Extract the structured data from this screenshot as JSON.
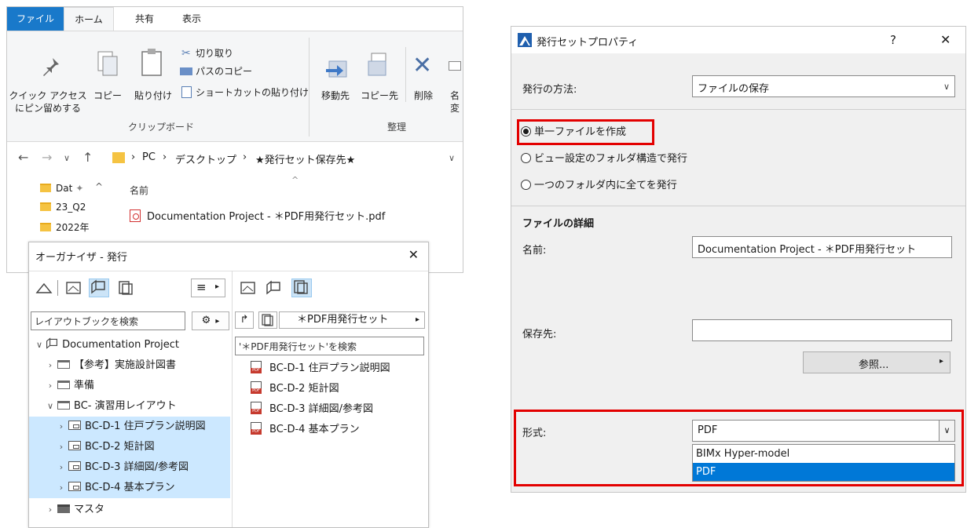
{
  "explorer": {
    "tabs": [
      "ファイル",
      "ホーム",
      "共有",
      "表示"
    ],
    "pin_label_1": "クイック アクセス",
    "pin_label_2": "にピン留めする",
    "copy_label": "コピー",
    "paste_label": "貼り付け",
    "cut_label": "切り取り",
    "copy_path_label": "パスのコピー",
    "paste_shortcut_label": "ショートカットの貼り付け",
    "clipboard_group": "クリップボード",
    "move_label": "移動先",
    "copyto_label": "コピー先",
    "delete_label": "削除",
    "rename_label_1": "名",
    "rename_label_2": "変",
    "organize_group": "整理",
    "breadcrumb": [
      "PC",
      "デスクトップ",
      "★発行セット保存先★"
    ],
    "nav_items": [
      "Dat",
      "23_Q2",
      "2022年"
    ],
    "column_name": "名前",
    "file_name": "Documentation Project - ＊PDF用発行セット.pdf"
  },
  "organizer": {
    "title": "オーガナイザ - 発行",
    "search_placeholder": "レイアウトブックを検索",
    "set_name": "＊PDF用発行セット",
    "set_search_placeholder": "'＊PDF用発行セット'を検索",
    "tree": [
      {
        "label": "Documentation Project",
        "expanded": true,
        "selected": false
      },
      {
        "label": "【参考】実施設計図書",
        "expanded": false,
        "selected": false
      },
      {
        "label": "準備",
        "expanded": false,
        "selected": false
      },
      {
        "label": "BC- 演習用レイアウト",
        "expanded": true,
        "selected": false
      },
      {
        "label": "BC-D-1 住戸プラン説明図",
        "expanded": false,
        "selected": true
      },
      {
        "label": "BC-D-2 矩計図",
        "expanded": false,
        "selected": true
      },
      {
        "label": "BC-D-3 詳細図/参考図",
        "expanded": false,
        "selected": true
      },
      {
        "label": "BC-D-4 基本プラン",
        "expanded": false,
        "selected": true
      },
      {
        "label": "マスタ",
        "expanded": false,
        "selected": false
      }
    ],
    "sheets": [
      "BC-D-1 住戸プラン説明図",
      "BC-D-2 矩計図",
      "BC-D-3 詳細図/参考図",
      "BC-D-4 基本プラン"
    ]
  },
  "dialog": {
    "title": "発行セットプロパティ",
    "help": "?",
    "close": "✕",
    "method_label": "発行の方法:",
    "method_value": "ファイルの保存",
    "radio_options": [
      "単一ファイルを作成",
      "ビュー設定のフォルダ構造で発行",
      "一つのフォルダ内に全てを発行"
    ],
    "radio_selected": 0,
    "details_heading": "ファイルの詳細",
    "name_label": "名前:",
    "name_value": "Documentation Project - ＊PDF用発行セット",
    "dest_label": "保存先:",
    "dest_value": "",
    "browse_label": "参照...",
    "format_label": "形式:",
    "format_value": "PDF",
    "format_options": [
      "BIMx Hyper-model",
      "PDF"
    ],
    "format_highlight": 1,
    "highlight_color": "#e30000",
    "accent_color": "#0078d7"
  }
}
